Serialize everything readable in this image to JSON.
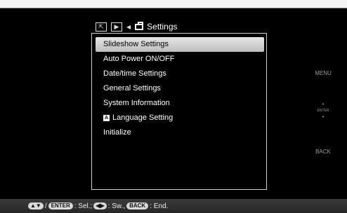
{
  "header": {
    "tab_title": "Settings",
    "tab_icons": [
      "zoom-tab-icon",
      "playback-tab-icon"
    ]
  },
  "menu": {
    "items": [
      {
        "label": "Slideshow Settings",
        "selected": true
      },
      {
        "label": "Auto Power ON/OFF"
      },
      {
        "label": "Date/time Settings"
      },
      {
        "label": "General Settings"
      },
      {
        "label": "System Information"
      },
      {
        "label": "Language Setting",
        "icon": "language-icon"
      },
      {
        "label": "Initialize"
      }
    ]
  },
  "side_buttons": {
    "menu": "MENU",
    "enter": "ENTER",
    "back": "BACK"
  },
  "footer": {
    "enter_key": "ENTER",
    "select_text": ": Sel.;",
    "switch_text": ": Sw.,",
    "back_key": "BACK",
    "end_text": ": End."
  },
  "colors": {
    "background": "#000000",
    "selection": "#d0d0d0",
    "side_text": "#9a9a9a"
  }
}
